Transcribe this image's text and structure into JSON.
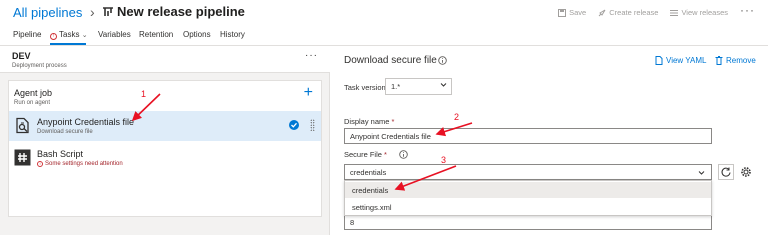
{
  "header": {
    "breadcrumb_root": "All pipelines",
    "breadcrumb_sep": "›",
    "title": "New release pipeline",
    "actions": [
      {
        "label": "Save",
        "icon": "save-icon"
      },
      {
        "label": "Create release",
        "icon": "rocket-icon"
      },
      {
        "label": "View releases",
        "icon": "list-icon"
      }
    ],
    "more": "···"
  },
  "tabs": [
    "Pipeline",
    "Tasks",
    "Variables",
    "Retention",
    "Options",
    "History"
  ],
  "tasks_tab_chevron": "⌄",
  "stage": {
    "name": "DEV",
    "subtitle": "Deployment process",
    "more": "···"
  },
  "agent_job": {
    "title": "Agent job",
    "subtitle": "Run on agent",
    "add": "+"
  },
  "task_items": [
    {
      "title": "Anypoint Credentials file",
      "subtitle": "Download secure file",
      "selected": true
    },
    {
      "title": "Bash Script",
      "subtitle": "Some settings need attention",
      "warning": true
    }
  ],
  "panel": {
    "title": "Download secure file",
    "view_yaml": "View YAML",
    "remove": "Remove",
    "task_version_label": "Task version",
    "task_version_value": "1.*",
    "display_name_label": "Display name",
    "display_name_value": "Anypoint Credentials file",
    "secure_file_label": "Secure File",
    "secure_file_value": "credentials",
    "dropdown_options": [
      "credentials",
      "settings.xml"
    ],
    "bottom_value": "8",
    "required_mark": "*"
  },
  "annotations": [
    "1",
    "2",
    "3"
  ],
  "colors": {
    "accent": "#0078d4",
    "annotation": "#e81123",
    "selected_row": "#deecf9",
    "warning": "#a4262c"
  }
}
